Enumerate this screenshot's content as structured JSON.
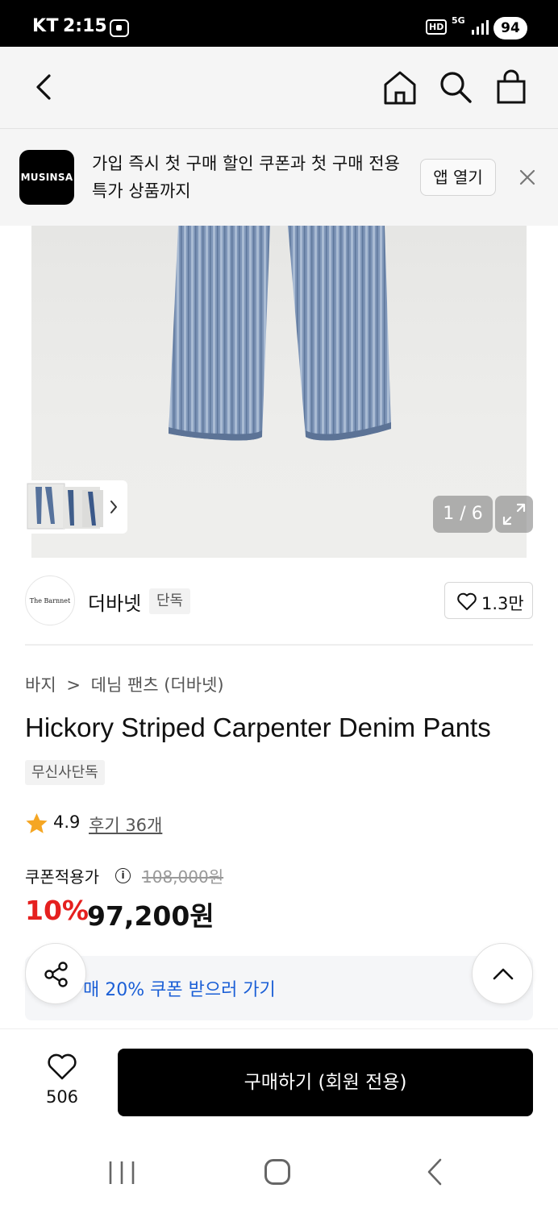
{
  "status_bar": {
    "carrier": "KT",
    "time": "2:15",
    "network_hd": "HD",
    "network_5g": "5G",
    "battery": "94"
  },
  "header": {
    "icons": [
      "back-icon",
      "home-icon",
      "search-icon",
      "shopping-bag-icon"
    ]
  },
  "app_banner": {
    "logo_text": "MUSINSA",
    "message": "가입 즉시 첫 구매 할인 쿠폰과 첫 구매 전용 특가 상품까지",
    "open_app_label": "앱 열기"
  },
  "gallery": {
    "counter": "1 / 6"
  },
  "brand": {
    "logo_text": "The Barnnet",
    "name": "더바넷",
    "tag": "단독",
    "like_count": "1.3만"
  },
  "product": {
    "breadcrumb": [
      "바지",
      ">",
      "데님 팬츠 (더바넷)"
    ],
    "title": "Hickory Striped Carpenter Denim Pants",
    "exclusive_tag": "무신사단독",
    "rating": "4.9",
    "review_link": "후기 36개",
    "price_label": "쿠폰적용가",
    "original_price": "108,000원",
    "discount": "10%",
    "sale_price": "97,200원"
  },
  "coupon": {
    "text": "매 20% 쿠폰 받으러 가기"
  },
  "bottom_bar": {
    "wish_count": "506",
    "buy_label": "구매하기 (회원 전용)"
  },
  "colors": {
    "discount": "#e5201f",
    "coupon_link": "#1b5fd6",
    "buy_button": "#000000"
  }
}
